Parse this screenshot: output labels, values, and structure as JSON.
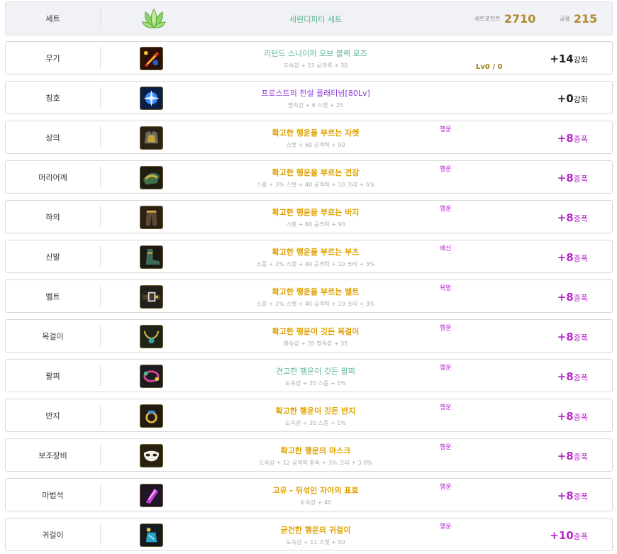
{
  "set_row": {
    "slot": "세트",
    "name": "세렌디피티 세트",
    "points_label": "세트포인트",
    "points_value": "2710",
    "common_label": "공용",
    "common_value": "215"
  },
  "items": [
    {
      "slot": "무기",
      "icon": "weapon-red-icon",
      "name": "리턴드 스나이퍼 오브 블랙 로즈",
      "name_color": "unique",
      "stats": "도속강 + 15 공격력 + 30",
      "potential": "",
      "lv": "Lv0 / 0",
      "enh": "+14",
      "unit": "강화",
      "enh_type": "normal"
    },
    {
      "slot": "칭호",
      "icon": "title-blue-icon",
      "name": "프로스트의 전설 플래티넘[80Lv]",
      "name_color": "purple",
      "stats": "명속강 + 6 스탯 + 25",
      "potential": "",
      "lv": "",
      "enh": "+0",
      "unit": "강화",
      "enh_type": "normal"
    },
    {
      "slot": "상의",
      "icon": "jacket-icon",
      "name": "확고한 행운을 부르는 자켓",
      "name_color": "legend",
      "stats": "스탯 + 60 공격력 + 90",
      "potential": "행운",
      "lv": "",
      "enh": "+8",
      "unit": "증폭",
      "enh_type": "star"
    },
    {
      "slot": "머리어깨",
      "icon": "shoulder-icon",
      "name": "확고한 행운을 부르는 견장",
      "name_color": "legend",
      "stats": "스증 + 3% 스탯 + 40 공격력 + 10 크리 + 5%",
      "potential": "행운",
      "lv": "",
      "enh": "+8",
      "unit": "증폭",
      "enh_type": "star"
    },
    {
      "slot": "하의",
      "icon": "pants-icon",
      "name": "확고한 행운을 부르는 바지",
      "name_color": "legend",
      "stats": "스탯 + 60 공격력 + 90",
      "potential": "행운",
      "lv": "",
      "enh": "+8",
      "unit": "증폭",
      "enh_type": "star"
    },
    {
      "slot": "신발",
      "icon": "boots-icon",
      "name": "확고한 행운을 부르는 부츠",
      "name_color": "legend",
      "stats": "스증 + 2% 스탯 + 40 공격력 + 10 크리 + 3%",
      "potential": "배신",
      "lv": "",
      "enh": "+8",
      "unit": "증폭",
      "enh_type": "star"
    },
    {
      "slot": "벨트",
      "icon": "belt-icon",
      "name": "확고한 행운을 부르는 벨트",
      "name_color": "legend",
      "stats": "스증 + 2% 스탯 + 40 공격력 + 10 크리 + 3%",
      "potential": "욕망",
      "lv": "",
      "enh": "+8",
      "unit": "증폭",
      "enh_type": "star"
    },
    {
      "slot": "목걸이",
      "icon": "necklace-icon",
      "name": "확고한 행운이 깃든 목걸이",
      "name_color": "legend",
      "stats": "화속강 + 35 명속강 + 35",
      "potential": "행운",
      "lv": "",
      "enh": "+8",
      "unit": "증폭",
      "enh_type": "star"
    },
    {
      "slot": "팔찌",
      "icon": "bracelet-icon",
      "name": "견고한 행운이 깃든 팔찌",
      "name_color": "unique",
      "stats": "도속강 + 35 스증 + 1%",
      "potential": "행운",
      "lv": "",
      "enh": "+8",
      "unit": "증폭",
      "enh_type": "star"
    },
    {
      "slot": "반지",
      "icon": "ring-icon",
      "name": "확고한 행운이 깃든 반지",
      "name_color": "legend",
      "stats": "도속강 + 35 스증 + 1%",
      "potential": "행운",
      "lv": "",
      "enh": "+8",
      "unit": "증폭",
      "enh_type": "star"
    },
    {
      "slot": "보조장비",
      "icon": "mask-icon",
      "name": "확고한 행운의 마스크",
      "name_color": "legend",
      "stats": "도속강 + 12 공격력 증폭 + 3% 크리 + 3.0%",
      "potential": "행운",
      "lv": "",
      "enh": "+8",
      "unit": "증폭",
      "enh_type": "star"
    },
    {
      "slot": "마법석",
      "icon": "magic-stone-icon",
      "name": "고유 - 뒤섞인 자아의 표효",
      "name_color": "legend",
      "stats": "도속강 + 40",
      "potential": "행운",
      "lv": "",
      "enh": "+8",
      "unit": "증폭",
      "enh_type": "star"
    },
    {
      "slot": "귀걸이",
      "icon": "earring-icon",
      "name": "굳건한 행운의 귀걸이",
      "name_color": "legend",
      "stats": "도속강 + 11 스탯 + 50",
      "potential": "행운",
      "lv": "",
      "enh": "+10",
      "unit": "증폭",
      "enh_type": "star"
    }
  ],
  "colors": {
    "legend": "#e0a100",
    "unique": "#5ab68e",
    "purple": "#8c38d9",
    "amplify": "#b829c9",
    "set_points": "#b08a2a"
  }
}
